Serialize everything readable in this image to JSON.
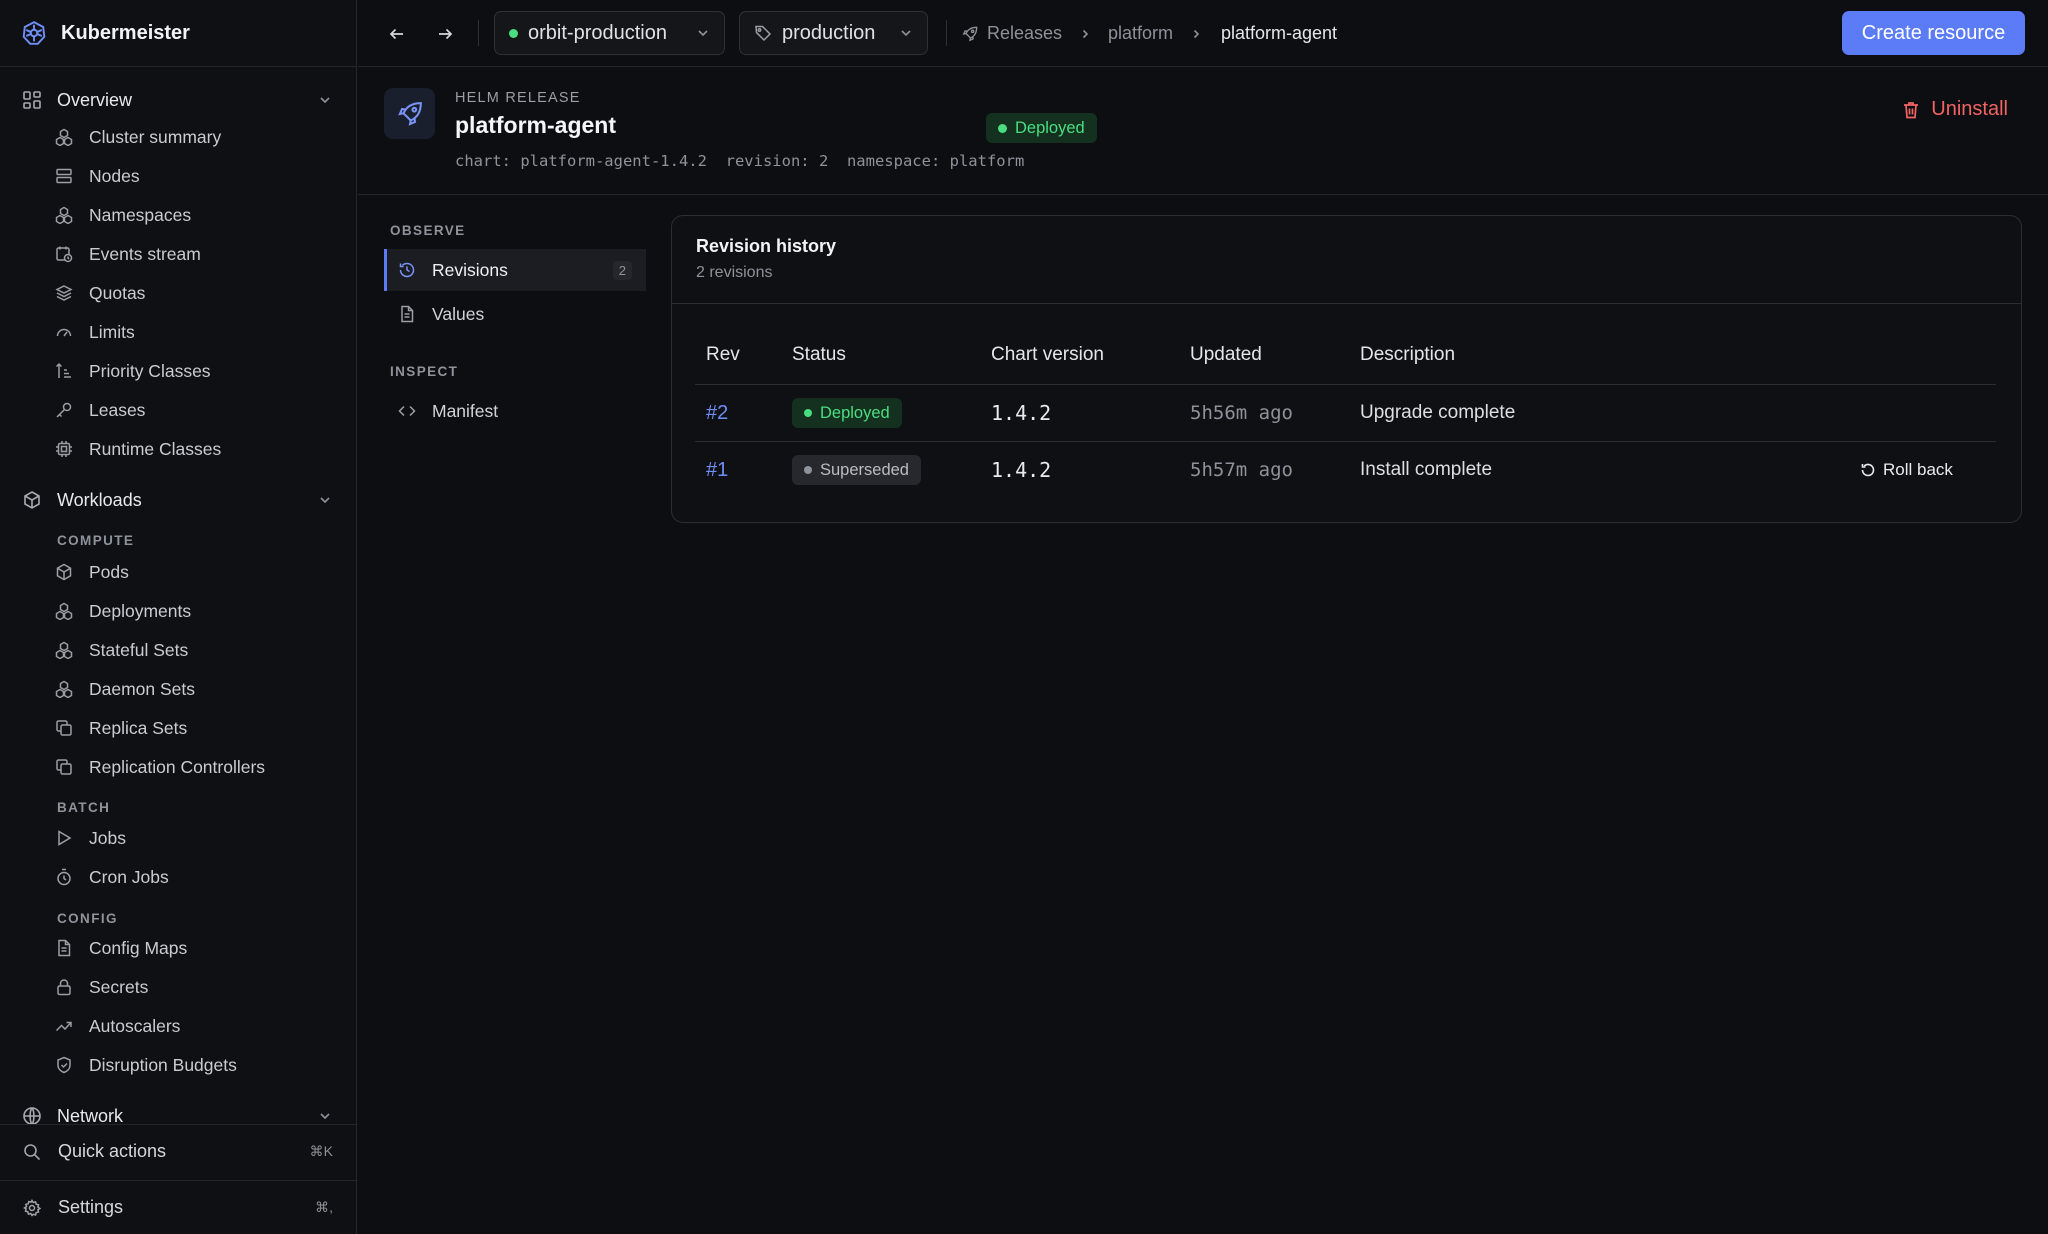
{
  "app": {
    "name": "Kubermeister"
  },
  "topbar": {
    "cluster": "orbit-production",
    "namespace": "production",
    "breadcrumb": [
      "Releases",
      "platform",
      "platform-agent"
    ],
    "create_label": "Create resource"
  },
  "sidebar": {
    "groups": {
      "overview": {
        "label": "Overview",
        "items": [
          "Cluster summary",
          "Nodes",
          "Namespaces",
          "Events stream",
          "Quotas",
          "Limits",
          "Priority Classes",
          "Leases",
          "Runtime Classes"
        ]
      },
      "workloads": {
        "label": "Workloads",
        "sections": {
          "compute": {
            "label": "COMPUTE",
            "items": [
              "Pods",
              "Deployments",
              "Stateful Sets",
              "Daemon Sets",
              "Replica Sets",
              "Replication Controllers"
            ]
          },
          "batch": {
            "label": "BATCH",
            "items": [
              "Jobs",
              "Cron Jobs"
            ]
          },
          "config": {
            "label": "CONFIG",
            "items": [
              "Config Maps",
              "Secrets",
              "Autoscalers",
              "Disruption Budgets"
            ]
          }
        }
      },
      "network": {
        "label": "Network"
      }
    },
    "quick_actions": {
      "label": "Quick actions",
      "shortcut": "⌘K"
    },
    "settings": {
      "label": "Settings",
      "shortcut": "⌘,"
    }
  },
  "release": {
    "eyebrow": "HELM RELEASE",
    "name": "platform-agent",
    "status": "Deployed",
    "chart_meta": "chart: platform-agent-1.4.2",
    "revision_meta": "revision: 2",
    "namespace_meta": "namespace: platform",
    "uninstall_label": "Uninstall"
  },
  "subnav": {
    "observe_label": "OBSERVE",
    "inspect_label": "INSPECT",
    "revisions": {
      "label": "Revisions",
      "count": "2"
    },
    "values": {
      "label": "Values"
    },
    "manifest": {
      "label": "Manifest"
    }
  },
  "revision_history": {
    "title": "Revision history",
    "subtitle": "2 revisions",
    "columns": [
      "Rev",
      "Status",
      "Chart version",
      "Updated",
      "Description"
    ],
    "rows": [
      {
        "rev": "#2",
        "status": "Deployed",
        "chart_version": "1.4.2",
        "updated": "5h56m ago",
        "description": "Upgrade complete"
      },
      {
        "rev": "#1",
        "status": "Superseded",
        "chart_version": "1.4.2",
        "updated": "5h57m ago",
        "description": "Install complete",
        "action": "Roll back"
      }
    ]
  },
  "colors": {
    "accent": "#5b7cf6",
    "success": "#4ade80",
    "danger": "#f26464",
    "background": "#0d0e11"
  }
}
